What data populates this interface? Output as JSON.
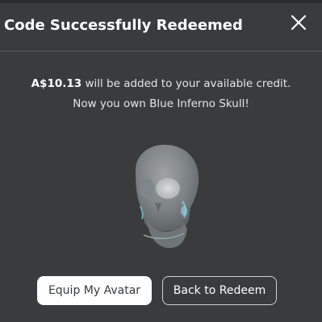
{
  "dialog": {
    "title": "Code Successfully Redeemed",
    "close_label": "close"
  },
  "message": {
    "amount": "A$10.13",
    "line1_rest": " will be added to your available credit.",
    "line2": "Now you own Blue Inferno Skull!"
  },
  "item": {
    "name": "Blue Inferno Skull",
    "icon": "skull-icon"
  },
  "buttons": {
    "equip_label": "Equip My Avatar",
    "back_label": "Back to Redeem"
  },
  "colors": {
    "background": "#393b3d",
    "primary_button_bg": "#ffffff",
    "text": "#ffffff"
  }
}
